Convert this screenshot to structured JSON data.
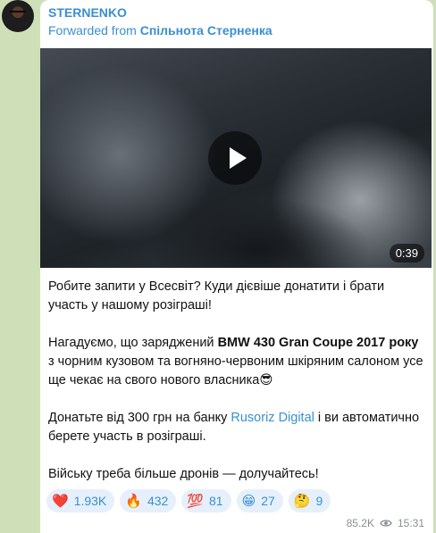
{
  "message": {
    "sender": "STERNENKO",
    "forwarded_prefix": "Forwarded from",
    "forwarded_source": "Спільнота Стерненка",
    "video": {
      "duration": "0:39"
    },
    "paragraphs": {
      "p1": "Робите запити у Всесвіт? Куди дієвіше донатити і брати участь у нашому розіграші!",
      "p2_before": "Нагадуємо, що заряджений ",
      "p2_bold": "BMW 430 Gran Coupe 2017 року",
      "p2_after": " з чорним кузовом та вогняно-червоним шкіряним салоном усе ще чекає на свого нового власника",
      "p2_emoji": "😎",
      "p3_before": "Донатьте від 300 грн на банку ",
      "p3_link": "Rusoriz Digital",
      "p3_after": " і ви автоматично берете участь в розіграші.",
      "p4": "Війську треба більше дронів — долучайтесь!"
    },
    "reactions": [
      {
        "emoji": "❤️",
        "count": "1.93K"
      },
      {
        "emoji": "🔥",
        "count": "432"
      },
      {
        "emoji": "💯",
        "count": "81"
      },
      {
        "emoji": "😁",
        "count": "27"
      },
      {
        "emoji": "🤔",
        "count": "9"
      }
    ],
    "views": "85.2K",
    "time": "15:31"
  }
}
